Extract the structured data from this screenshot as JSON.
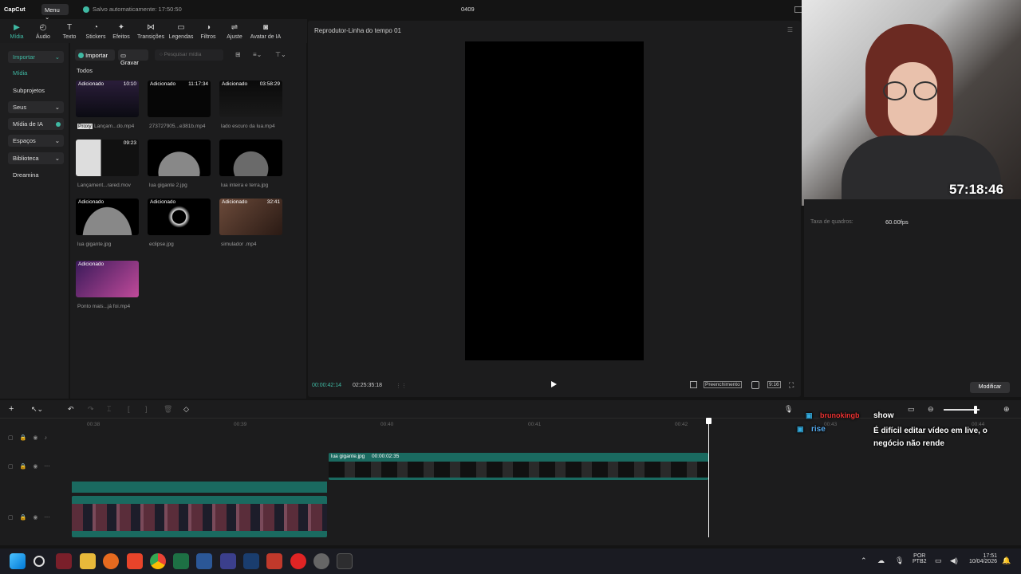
{
  "app": {
    "logo": "CapCut",
    "menu_label": "Menu",
    "autosave": "Salvo automaticamente: 17:50:50",
    "project_name": "0409"
  },
  "toolbar": [
    {
      "label": "Mídia",
      "icon": "media-icon"
    },
    {
      "label": "Áudio",
      "icon": "audio-icon"
    },
    {
      "label": "Texto",
      "icon": "text-icon"
    },
    {
      "label": "Stickers",
      "icon": "sticker-icon"
    },
    {
      "label": "Efeitos",
      "icon": "effects-icon"
    },
    {
      "label": "Transições",
      "icon": "transitions-icon"
    },
    {
      "label": "Legendas",
      "icon": "captions-icon"
    },
    {
      "label": "Filtros",
      "icon": "filters-icon"
    },
    {
      "label": "Ajuste",
      "icon": "adjust-icon"
    },
    {
      "label": "Avatar de IA",
      "icon": "avatar-icon"
    }
  ],
  "sidebar": {
    "items": [
      {
        "label": "Importar"
      },
      {
        "label": "Mídia"
      },
      {
        "label": "Subprojetos"
      },
      {
        "label": "Seus"
      },
      {
        "label": "Mídia de IA"
      },
      {
        "label": "Espaços"
      },
      {
        "label": "Biblioteca"
      },
      {
        "label": "Dreamina"
      }
    ]
  },
  "media_panel": {
    "import_label": "Importar",
    "record_label": "Gravar",
    "search_placeholder": "Pesquisar mídia",
    "section_label": "Todos",
    "proxy_label": "Proxy",
    "items": [
      {
        "status": "Adicionado",
        "duration": "10:10",
        "name": "Lançam...do.mp4"
      },
      {
        "status": "Adicionado",
        "duration": "11:17:34",
        "name": "273727905...e381b.mp4"
      },
      {
        "status": "Adicionado",
        "duration": "03:58:29",
        "name": "lado escuro da lua.mp4"
      },
      {
        "status": "",
        "duration": "09:23",
        "name": "Lançament...rared.mov"
      },
      {
        "status": "",
        "duration": "",
        "name": "lua gigante 2.jpg"
      },
      {
        "status": "",
        "duration": "",
        "name": "lua inteira e terra.jpg"
      },
      {
        "status": "Adicionado",
        "duration": "",
        "name": "lua gigante.jpg"
      },
      {
        "status": "Adicionado",
        "duration": "",
        "name": "eclipse.jpg"
      },
      {
        "status": "Adicionado",
        "duration": "32:41",
        "name": "simulador .mp4"
      },
      {
        "status": "Adicionado",
        "duration": "",
        "name": "Ponto mais...já foi.mp4"
      }
    ]
  },
  "player": {
    "title": "Reprodutor-Linha do tempo 01",
    "current_time": "00:00:42:14",
    "total_time": "02:25:35:18",
    "fill_label": "Preenchimento",
    "ratio_label": "9:16"
  },
  "properties": {
    "frame_rate_label": "Taxa de quadros:",
    "frame_rate_value": "60.00fps",
    "modify_label": "Modificar"
  },
  "webcam": {
    "timer": "57:18:46"
  },
  "timeline": {
    "ruler": [
      "00:38",
      "00:39",
      "00:40",
      "00:41",
      "00:42",
      "00:43",
      "00:44"
    ],
    "clip_label": "lua gigante.jpg",
    "clip_duration": "00:00:02:35"
  },
  "chat": [
    {
      "user": "brunokingb",
      "message": "show"
    },
    {
      "user": "rise",
      "message": "É difícil editar vídeo em live, o negócio não rende"
    }
  ],
  "taskbar": {
    "lang": "POR",
    "layout": "PTB2",
    "time": "17:51",
    "date": "10/04/2026"
  }
}
